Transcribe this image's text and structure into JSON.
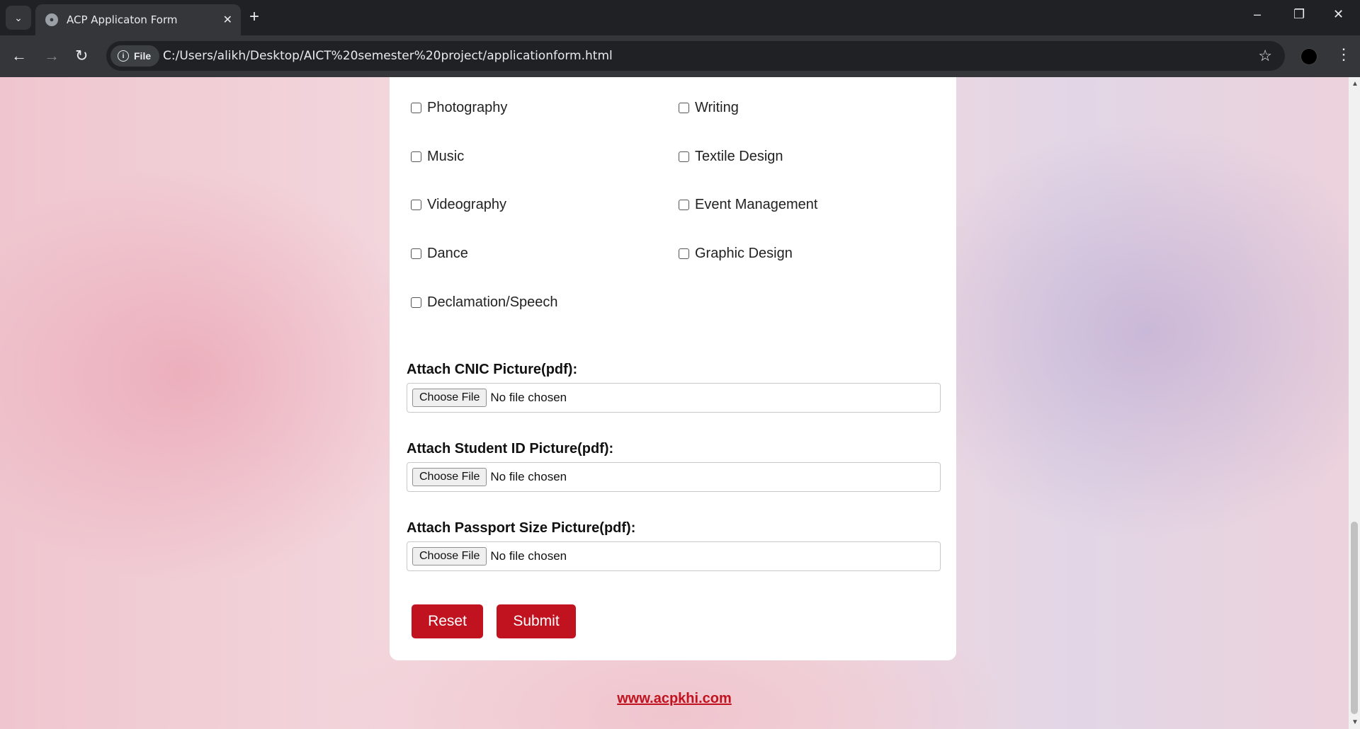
{
  "browser": {
    "tab_title": "ACP Applicaton Form",
    "file_chip": "File",
    "url": "C:/Users/alikh/Desktop/AICT%20semester%20project/applicationform.html",
    "icons": [
      "tab-search-icon",
      "globe-icon",
      "close-icon",
      "plus-icon",
      "minimize-icon",
      "restore-icon",
      "back-icon",
      "forward-icon",
      "reload-icon",
      "info-icon",
      "star-icon",
      "profile-icon",
      "kebab-menu-icon"
    ]
  },
  "form": {
    "interests": [
      {
        "label": "Photography",
        "checked": false
      },
      {
        "label": "Writing",
        "checked": false
      },
      {
        "label": "Music",
        "checked": false
      },
      {
        "label": "Textile Design",
        "checked": false
      },
      {
        "label": "Videography",
        "checked": false
      },
      {
        "label": "Event Management",
        "checked": false
      },
      {
        "label": "Dance",
        "checked": false
      },
      {
        "label": "Graphic Design",
        "checked": false
      },
      {
        "label": "Declamation/Speech",
        "checked": false
      }
    ],
    "attachments": [
      {
        "label": "Attach CNIC Picture(pdf):",
        "button": "Choose File",
        "status": "No file chosen"
      },
      {
        "label": "Attach Student ID Picture(pdf):",
        "button": "Choose File",
        "status": "No file chosen"
      },
      {
        "label": "Attach Passport Size Picture(pdf):",
        "button": "Choose File",
        "status": "No file chosen"
      }
    ],
    "reset_label": "Reset",
    "submit_label": "Submit"
  },
  "footer": {
    "link_text": "www.acpkhi.com"
  },
  "colors": {
    "accent": "#c1121f",
    "card": "#ffffff",
    "chrome_dark": "#202124",
    "chrome_toolbar": "#35363a"
  }
}
